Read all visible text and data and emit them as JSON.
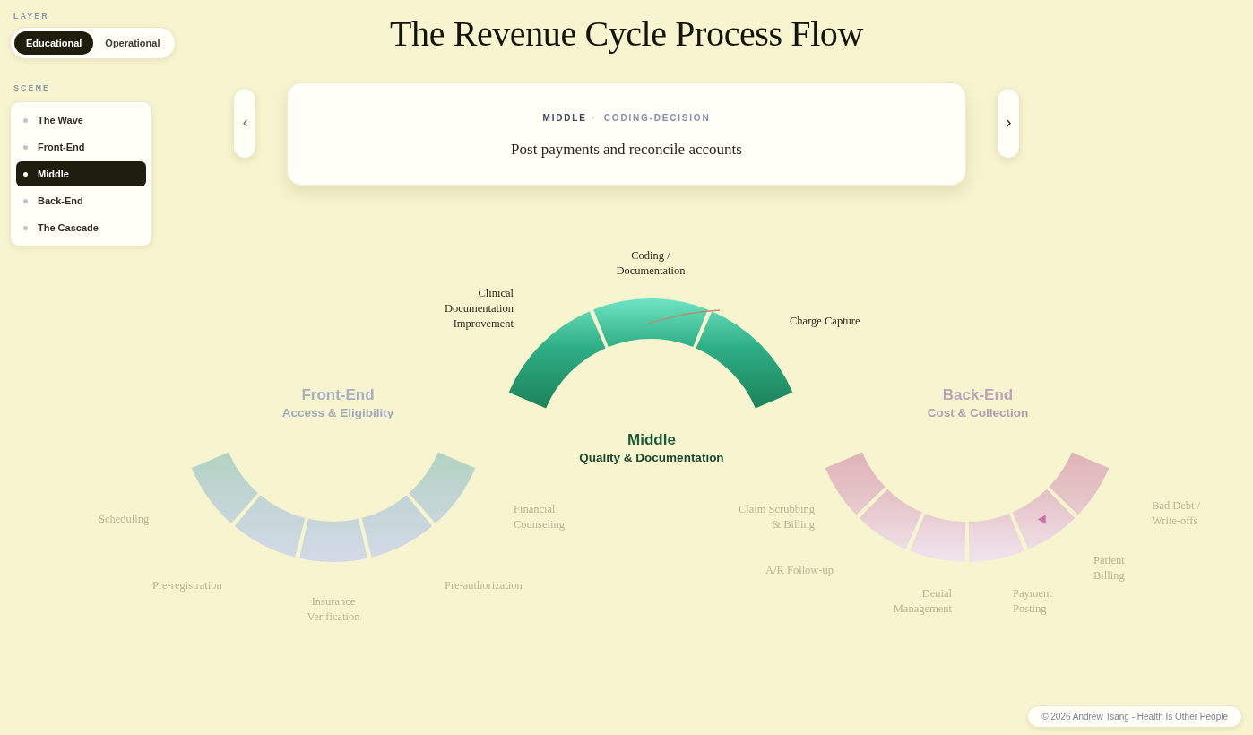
{
  "sidebar": {
    "layer": {
      "label": "LAYER",
      "options": [
        {
          "label": "Educational",
          "selected": true
        },
        {
          "label": "Operational",
          "selected": false
        }
      ]
    },
    "scene": {
      "label": "SCENE",
      "items": [
        {
          "label": "The Wave",
          "selected": false
        },
        {
          "label": "Front-End",
          "selected": false
        },
        {
          "label": "Middle",
          "selected": true
        },
        {
          "label": "Back-End",
          "selected": false
        },
        {
          "label": "The Cascade",
          "selected": false
        }
      ]
    }
  },
  "title": "The Revenue Cycle Process Flow",
  "step_card": {
    "phase": "MIDDLE",
    "separator": "·",
    "step": "CODING-DECISION",
    "text": "Post payments and reconcile accounts"
  },
  "diagram": {
    "sections": [
      {
        "kind": "bowl",
        "active": false,
        "title": "Front-End",
        "subtitle": "Access & Eligibility",
        "stages": [
          {
            "label": "Scheduling",
            "marker": false
          },
          {
            "label": "Pre-registration",
            "marker": false
          },
          {
            "label": "Insurance Verification",
            "marker": false
          },
          {
            "label": "Pre-authorization",
            "marker": false
          },
          {
            "label": "Financial Counseling",
            "marker": false
          }
        ]
      },
      {
        "kind": "arch",
        "active": true,
        "title": "Middle",
        "subtitle": "Quality & Documentation",
        "stages": [
          {
            "label": "Clinical Documentation Improvement",
            "marker": false
          },
          {
            "label": "Coding / Documentation",
            "marker": false
          },
          {
            "label": "Charge Capture",
            "marker": false
          }
        ]
      },
      {
        "kind": "bowl",
        "active": false,
        "title": "Back-End",
        "subtitle": "Cost & Collection",
        "stages": [
          {
            "label": "Claim Scrubbing & Billing",
            "marker": false
          },
          {
            "label": "A/R Follow-up",
            "marker": false
          },
          {
            "label": "Denial Management",
            "marker": false
          },
          {
            "label": "Payment Posting",
            "marker": false
          },
          {
            "label": "Patient Billing",
            "marker": true
          },
          {
            "label": "Bad Debt / Write-offs",
            "marker": false
          }
        ]
      }
    ]
  },
  "footer": "© 2026 Andrew Tsang - Health Is Other People"
}
